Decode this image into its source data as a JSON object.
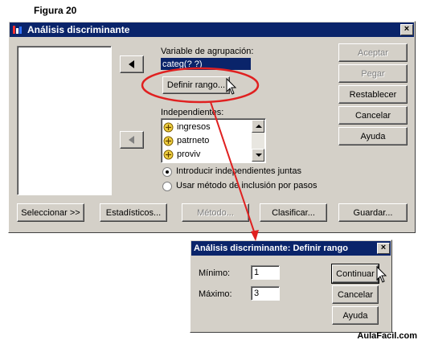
{
  "caption": "Figura 20",
  "main_dialog": {
    "title": "Análisis discriminante",
    "grouping_label": "Variable de agrupación:",
    "grouping_value": "categ(? ?)",
    "define_range_label": "Definir rango...",
    "independents_label": "Independientes:",
    "independents": [
      "ingresos",
      "patrneto",
      "proviv"
    ],
    "radio_options": [
      {
        "label": "Introducir independientes juntas",
        "selected": true
      },
      {
        "label": "Usar método de inclusión por pasos",
        "selected": false
      }
    ],
    "right_buttons": [
      {
        "label": "Aceptar",
        "enabled": false
      },
      {
        "label": "Pegar",
        "enabled": false
      },
      {
        "label": "Restablecer",
        "enabled": true
      },
      {
        "label": "Cancelar",
        "enabled": true
      },
      {
        "label": "Ayuda",
        "enabled": true
      }
    ],
    "bottom_buttons": [
      {
        "label": "Seleccionar >>",
        "enabled": true
      },
      {
        "label": "Estadísticos...",
        "enabled": true
      },
      {
        "label": "Método...",
        "enabled": false
      },
      {
        "label": "Clasificar...",
        "enabled": true
      },
      {
        "label": "Guardar...",
        "enabled": true
      }
    ],
    "close_glyph": "×"
  },
  "range_dialog": {
    "title": "Análisis discriminante: Definir rango",
    "min_label": "Mínimo:",
    "min_value": "1",
    "max_label": "Máximo:",
    "max_value": "3",
    "buttons": [
      "Continuar",
      "Cancelar",
      "Ayuda"
    ],
    "close_glyph": "×"
  },
  "annotation_color": "#e02020",
  "footer": "AulaFacil.com"
}
